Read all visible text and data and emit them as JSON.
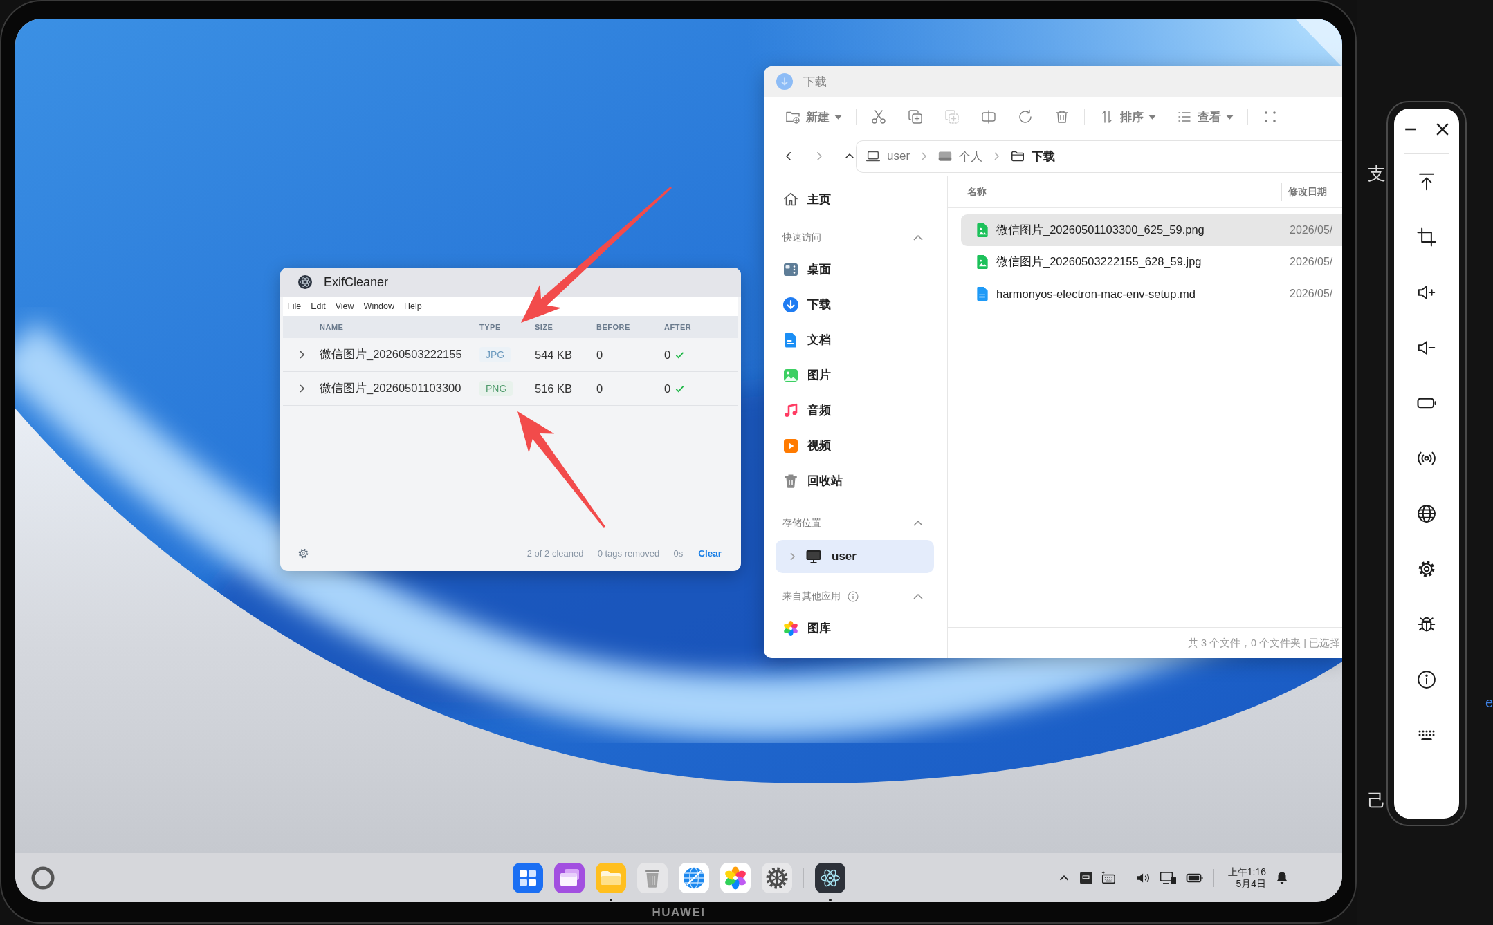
{
  "device": {
    "brand": "HUAWEI"
  },
  "exif_window": {
    "title": "ExifCleaner",
    "menu": [
      "File",
      "Edit",
      "View",
      "Window",
      "Help"
    ],
    "columns": [
      "NAME",
      "TYPE",
      "SIZE",
      "BEFORE",
      "AFTER"
    ],
    "rows": [
      {
        "name": "微信图片_20260503222155",
        "type": "JPG",
        "color": "#6d9bbf",
        "size": "544 KB",
        "before": "0",
        "after": "0",
        "cleaned": true
      },
      {
        "name": "微信图片_20260501103300",
        "type": "PNG",
        "color": "#4f9a6b",
        "size": "516 KB",
        "before": "0",
        "after": "0",
        "cleaned": true
      }
    ],
    "status": "2 of 2 cleaned — 0 tags removed — 0s",
    "clear": "Clear"
  },
  "file_manager": {
    "title": "下载",
    "toolbar_groups": [
      {
        "items": [
          {
            "kind": "new",
            "label": "新建",
            "disabled": false
          }
        ]
      },
      {
        "items": [
          {
            "kind": "cut",
            "disabled": false
          },
          {
            "kind": "copy",
            "disabled": false
          },
          {
            "kind": "paste",
            "disabled": true
          },
          {
            "kind": "split",
            "disabled": false
          },
          {
            "kind": "rotate",
            "disabled": false
          },
          {
            "kind": "delete",
            "disabled": false
          }
        ]
      },
      {
        "items": [
          {
            "kind": "sort",
            "label": "排序",
            "disabled": false
          },
          {
            "kind": "view",
            "label": "查看",
            "disabled": false
          }
        ]
      },
      {
        "items": [
          {
            "kind": "more",
            "disabled": false
          }
        ]
      }
    ],
    "nav": [
      {
        "kind": "back",
        "disabled": false
      },
      {
        "kind": "forward",
        "disabled": true
      },
      {
        "kind": "up",
        "disabled": false
      }
    ],
    "breadcrumb": [
      {
        "kind": "computer",
        "label": "user",
        "current": false
      },
      {
        "kind": "drive",
        "label": "个人",
        "current": false
      },
      {
        "kind": "folder",
        "label": "下载",
        "current": true
      }
    ],
    "sidebar": {
      "home": {
        "label": "主页",
        "selected": false
      },
      "sections": [
        {
          "title": "快速访问",
          "expanded": true,
          "info_icon": false,
          "items": [
            {
              "kind": "desktop",
              "label": "桌面",
              "selected": false
            },
            {
              "kind": "downloads",
              "label": "下载",
              "selected": false
            },
            {
              "kind": "documents",
              "label": "文档",
              "selected": false
            },
            {
              "kind": "pictures",
              "label": "图片",
              "selected": false
            },
            {
              "kind": "music",
              "label": "音频",
              "selected": false
            },
            {
              "kind": "video",
              "label": "视频",
              "selected": false
            },
            {
              "kind": "trash",
              "label": "回收站",
              "selected": false
            }
          ]
        },
        {
          "title": "存储位置",
          "expanded": true,
          "info_icon": false,
          "items": [
            {
              "kind": "computer",
              "label": "user",
              "selected": true,
              "expanded": false
            }
          ]
        },
        {
          "title": "来自其他应用",
          "expanded": true,
          "info_icon": true,
          "items": [
            {
              "kind": "gallery",
              "label": "图库",
              "selected": false
            }
          ]
        }
      ]
    },
    "columns": [
      "名称",
      "修改日期"
    ],
    "files": [
      {
        "kind": "image",
        "name": "微信图片_20260501103300_625_59.png",
        "modified": "2026/05/",
        "selected": true
      },
      {
        "kind": "image",
        "name": "微信图片_20260503222155_628_59.jpg",
        "modified": "2026/05/",
        "selected": false
      },
      {
        "kind": "document",
        "name": "harmonyos-electron-mac-env-setup.md",
        "modified": "2026/05/",
        "selected": false
      }
    ],
    "status": "共 3 个文件，0 个文件夹 | 已选择"
  },
  "taskbar": {
    "dock_groups": [
      {
        "items": [
          {
            "kind": "apps",
            "running": false
          },
          {
            "kind": "multitask",
            "running": false
          },
          {
            "kind": "files",
            "running": true
          },
          {
            "kind": "trash",
            "running": false
          },
          {
            "kind": "browser",
            "running": false
          },
          {
            "kind": "photos",
            "running": false
          },
          {
            "kind": "settings",
            "running": false
          }
        ]
      },
      {
        "items": [
          {
            "kind": "electron",
            "running": true
          }
        ]
      }
    ],
    "input_method": "中",
    "time": "上午1:16",
    "date": "5月4日"
  },
  "emulator_toolbar": {
    "tools": [
      {
        "kind": "top"
      },
      {
        "kind": "crop"
      },
      {
        "kind": "volume_up"
      },
      {
        "kind": "volume_down"
      },
      {
        "kind": "battery"
      },
      {
        "kind": "signal"
      },
      {
        "kind": "globe"
      },
      {
        "kind": "settings"
      },
      {
        "kind": "bug"
      },
      {
        "kind": "info"
      },
      {
        "kind": "keyboard"
      }
    ]
  },
  "background_window": {
    "texts": [
      "支",
      "己"
    ],
    "link": "e"
  }
}
